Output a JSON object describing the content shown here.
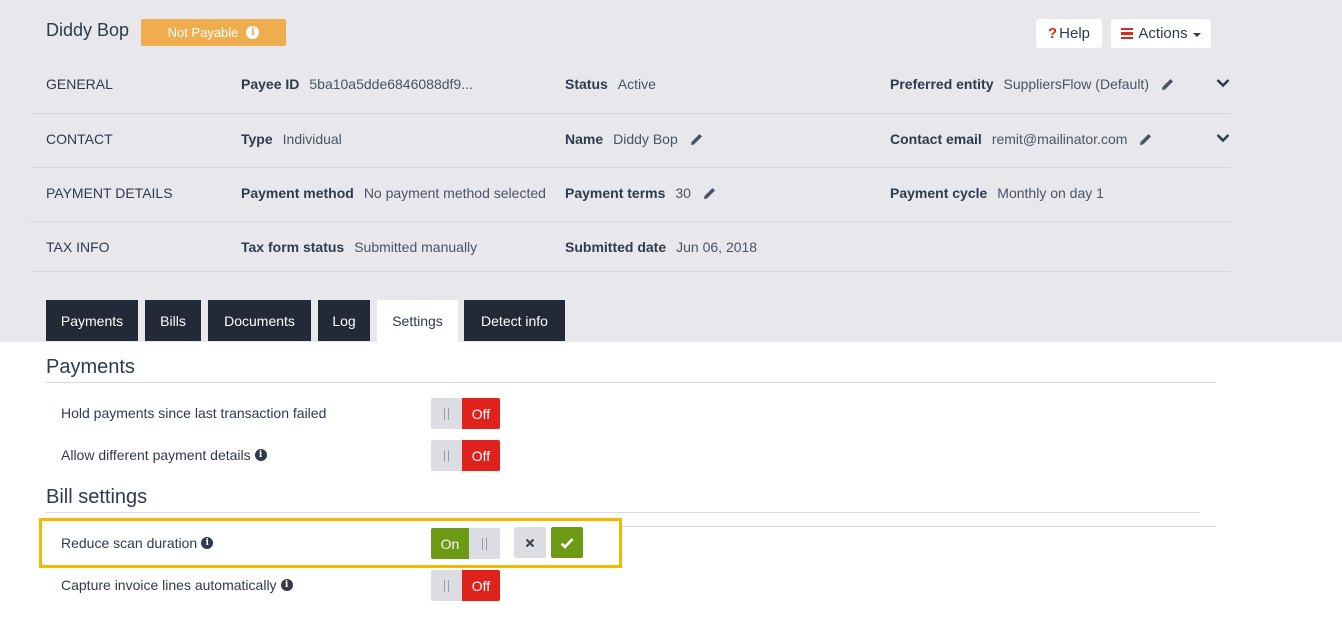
{
  "header": {
    "payee_name": "Diddy Bop",
    "status_pill": "Not Payable",
    "help_label": "Help",
    "actions_label": "Actions"
  },
  "rows": [
    {
      "section": "GENERAL",
      "fields": [
        {
          "label": "Payee ID",
          "value": "5ba10a5dde6846088df9..."
        },
        {
          "label": "Status",
          "value": "Active"
        },
        {
          "label": "Preferred entity",
          "value": "SuppliersFlow (Default)"
        }
      ]
    },
    {
      "section": "CONTACT",
      "fields": [
        {
          "label": "Type",
          "value": "Individual"
        },
        {
          "label": "Name",
          "value": "Diddy Bop"
        },
        {
          "label": "Contact email",
          "value": "remit@mailinator.com"
        }
      ]
    },
    {
      "section": "PAYMENT DETAILS",
      "fields": [
        {
          "label": "Payment method",
          "value": "No payment method selected"
        },
        {
          "label": "Payment terms",
          "value": "30"
        },
        {
          "label": "Payment cycle",
          "value": "Monthly on day 1"
        }
      ]
    },
    {
      "section": "TAX INFO",
      "fields": [
        {
          "label": "Tax form status",
          "value": "Submitted manually"
        },
        {
          "label": "Submitted date",
          "value": "Jun 06, 2018"
        }
      ]
    }
  ],
  "tabs": [
    {
      "label": "Payments"
    },
    {
      "label": "Bills"
    },
    {
      "label": "Documents"
    },
    {
      "label": "Log"
    },
    {
      "label": "Settings",
      "active": true
    },
    {
      "label": "Detect info"
    }
  ],
  "settings": {
    "payments_title": "Payments",
    "bill_title": "Bill settings",
    "items": [
      {
        "label": "Hold payments since last transaction failed",
        "state": "Off"
      },
      {
        "label": "Allow different payment details",
        "state": "Off"
      },
      {
        "label": "Reduce scan duration",
        "state": "On"
      },
      {
        "label": "Capture invoice lines automatically",
        "state": "Off"
      }
    ]
  },
  "colors": {
    "pill": "#f0ad4e",
    "toggle_off": "#e0221c",
    "toggle_on": "#6c9a14",
    "highlight": "#f5b800",
    "tab_dark": "#232936"
  }
}
